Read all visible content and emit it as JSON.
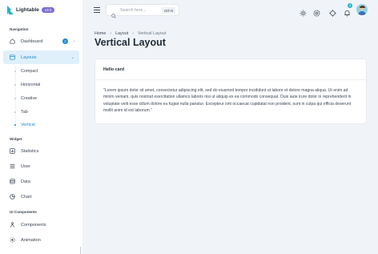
{
  "brand": {
    "name": "Lightable",
    "badge": "v3.5"
  },
  "sidebar": {
    "sections": [
      {
        "title": "Navigation"
      },
      {
        "title": "Widget"
      },
      {
        "title": "UI Components"
      }
    ],
    "items": [
      {
        "label": "Dashboard",
        "badge": "2",
        "icon": "home-icon"
      },
      {
        "label": "Layouts",
        "icon": "layout-icon"
      },
      {
        "label": "Statistics",
        "icon": "chart-icon"
      },
      {
        "label": "User",
        "icon": "user-icon"
      },
      {
        "label": "Data",
        "icon": "database-icon"
      },
      {
        "label": "Chart",
        "icon": "pie-icon"
      },
      {
        "label": "Components",
        "icon": "components-icon"
      },
      {
        "label": "Animation",
        "icon": "animation-icon"
      }
    ],
    "layout_sub": [
      {
        "label": "Compact"
      },
      {
        "label": "Horizontal"
      },
      {
        "label": "Creative"
      },
      {
        "label": "Tab"
      },
      {
        "label": "Vertical"
      }
    ]
  },
  "topbar": {
    "search_placeholder": "Search here...",
    "search_shortcut": "ctrl+k",
    "notification_count": "3"
  },
  "breadcrumb": [
    "Home",
    "Layout",
    "Vertical Layout"
  ],
  "page_title": "Vertical Layout",
  "card": {
    "title": "Hello card",
    "body": "\"Lorem ipsum dolor sit amet, consectetur adipiscing elit, sed do eiusmod tempor incididunt ut labore et dolore magna aliqua. Ut enim ad minim veniam, quis nostrud exercitation ullamco laboris nisi ut aliquip ex ea commodo consequat. Duis aute irure dolor in reprehenderit in voluptate velit esse cillum dolore eu fugiat nulla pariatur. Excepteur sint occaecat cupidatat non proident, sunt in culpa qui officia deserunt mollit anim id est laborum.\""
  },
  "colors": {
    "accent": "#1a8ad1",
    "active_bg": "#dff0fb",
    "page_bg": "#f0f4f9",
    "brand": "#1fb6c9"
  }
}
